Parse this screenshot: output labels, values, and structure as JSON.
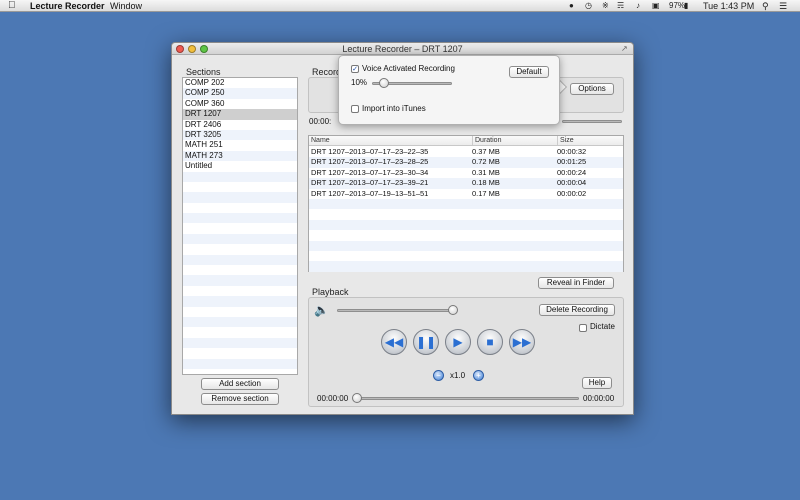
{
  "menubar": {
    "app_name": "Lecture Recorder",
    "menu_window": "Window",
    "battery": "97%",
    "clock": "Tue 1:43 PM"
  },
  "window": {
    "title": "Lecture Recorder – DRT 1207"
  },
  "sections": {
    "header": "Sections",
    "items": [
      "COMP 202",
      "COMP 250",
      "COMP 360",
      "DRT 1207",
      "DRT 2406",
      "DRT 3205",
      "MATH 251",
      "MATH 273",
      "Untitled"
    ],
    "selected_index": 3,
    "add_label": "Add section",
    "remove_label": "Remove section"
  },
  "record": {
    "label": "Record",
    "time": "00:00:",
    "options_label": "Options"
  },
  "popover": {
    "voice_activated_label": "Voice Activated Recording",
    "voice_activated_checked": true,
    "threshold_value": "10%",
    "threshold_fraction": 0.15,
    "import_itunes_label": "Import into iTunes",
    "import_itunes_checked": false,
    "default_label": "Default"
  },
  "files": {
    "columns": [
      "Name",
      "Duration",
      "Size"
    ],
    "rows": [
      {
        "name": "DRT 1207–2013–07–17–23–22–35",
        "duration": "0.37 MB",
        "size": "00:00:32"
      },
      {
        "name": "DRT 1207–2013–07–17–23–28–25",
        "duration": "0.72 MB",
        "size": "00:01:25"
      },
      {
        "name": "DRT 1207–2013–07–17–23–30–34",
        "duration": "0.31 MB",
        "size": "00:00:24"
      },
      {
        "name": "DRT 1207–2013–07–17–23–39–21",
        "duration": "0.18 MB",
        "size": "00:00:04"
      },
      {
        "name": "DRT 1207–2013–07–19–13–51–51",
        "duration": "0.17 MB",
        "size": "00:00:02"
      }
    ],
    "reveal_label": "Reveal in Finder"
  },
  "playback": {
    "label": "Playback",
    "delete_label": "Delete Recording",
    "dictate_label": "Dictate",
    "dictate_checked": false,
    "volume_fraction": 1.0,
    "speed": "x1.0",
    "help_label": "Help",
    "time_start": "00:00:00",
    "time_end": "00:00:00",
    "position_fraction": 0.0
  },
  "colors": {
    "desktop": "#4c78b4",
    "accent": "#2b6fd2"
  }
}
